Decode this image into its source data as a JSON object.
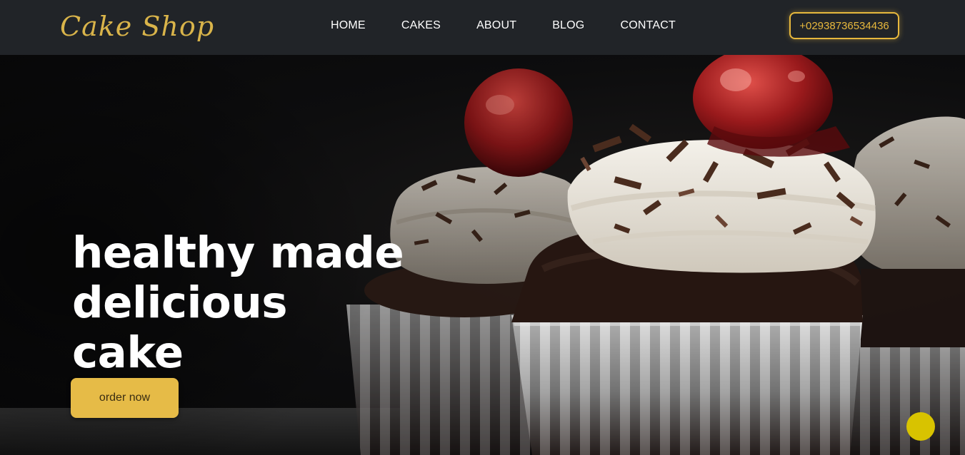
{
  "header": {
    "logo_text": "Cake Shop",
    "nav": [
      {
        "label": "HOME"
      },
      {
        "label": "CAKES"
      },
      {
        "label": "ABOUT"
      },
      {
        "label": "BLOG"
      },
      {
        "label": "CONTACT"
      }
    ],
    "phone": "+02938736534436"
  },
  "hero": {
    "title_line1": "healthy made",
    "title_line2": "delicious",
    "title_line3": "cake",
    "order_label": "order now",
    "image_icon": "cupcake-photo"
  },
  "floating_button": {
    "icon": "chat-bubble-icon"
  },
  "colors": {
    "accent": "#e6bb47",
    "nav_bg": "#212428",
    "float": "#d8c300"
  }
}
